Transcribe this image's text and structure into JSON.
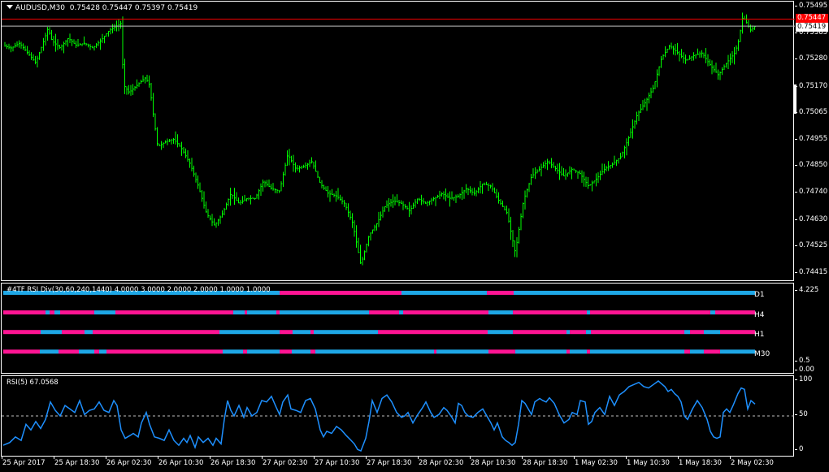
{
  "main": {
    "symbol_label": "AUDUSD,M30",
    "ohlc": "0.75428 0.75447 0.75397 0.75419",
    "ylim": [
      0.74395,
      0.75505
    ],
    "price_ticks": [
      "0.75495",
      "0.75385",
      "0.75280",
      "0.75170",
      "0.75065",
      "0.74955",
      "0.74850",
      "0.74740",
      "0.74630",
      "0.74525",
      "0.74415"
    ],
    "ask_level": 0.75447,
    "bid_level": 0.75419,
    "ask_tag": "0.75447",
    "bid_tag": "0.75419",
    "bar_color": "#00ff00",
    "ask_color": "#ff0000",
    "bid_color": "#c0c0c0",
    "price_path": [
      [
        0,
        0.7534
      ],
      [
        10,
        0.7533
      ],
      [
        20,
        0.7535
      ],
      [
        30,
        0.7531
      ],
      [
        40,
        0.7527
      ],
      [
        50,
        0.7536
      ],
      [
        55,
        0.7541
      ],
      [
        60,
        0.7536
      ],
      [
        70,
        0.7533
      ],
      [
        80,
        0.7537
      ],
      [
        90,
        0.7534
      ],
      [
        100,
        0.7535
      ],
      [
        110,
        0.7533
      ],
      [
        120,
        0.7536
      ],
      [
        130,
        0.754
      ],
      [
        140,
        0.7542
      ],
      [
        145,
        0.7543
      ],
      [
        148,
        0.7518
      ],
      [
        155,
        0.7515
      ],
      [
        165,
        0.7518
      ],
      [
        175,
        0.7521
      ],
      [
        180,
        0.7518
      ],
      [
        185,
        0.7505
      ],
      [
        190,
        0.7493
      ],
      [
        200,
        0.7495
      ],
      [
        210,
        0.7496
      ],
      [
        220,
        0.7492
      ],
      [
        230,
        0.7486
      ],
      [
        240,
        0.7477
      ],
      [
        250,
        0.7466
      ],
      [
        260,
        0.7461
      ],
      [
        270,
        0.7466
      ],
      [
        280,
        0.7474
      ],
      [
        290,
        0.747
      ],
      [
        300,
        0.7472
      ],
      [
        310,
        0.7472
      ],
      [
        320,
        0.7479
      ],
      [
        330,
        0.7476
      ],
      [
        340,
        0.7475
      ],
      [
        350,
        0.749
      ],
      [
        360,
        0.7484
      ],
      [
        370,
        0.7485
      ],
      [
        380,
        0.7487
      ],
      [
        390,
        0.7478
      ],
      [
        400,
        0.7474
      ],
      [
        410,
        0.7473
      ],
      [
        420,
        0.747
      ],
      [
        430,
        0.7462
      ],
      [
        440,
        0.7445
      ],
      [
        450,
        0.7457
      ],
      [
        460,
        0.7462
      ],
      [
        470,
        0.7469
      ],
      [
        480,
        0.7471
      ],
      [
        490,
        0.747
      ],
      [
        500,
        0.7467
      ],
      [
        510,
        0.7472
      ],
      [
        520,
        0.747
      ],
      [
        530,
        0.7472
      ],
      [
        540,
        0.7474
      ],
      [
        550,
        0.7472
      ],
      [
        560,
        0.7473
      ],
      [
        570,
        0.7476
      ],
      [
        580,
        0.7474
      ],
      [
        590,
        0.7478
      ],
      [
        600,
        0.7477
      ],
      [
        610,
        0.7471
      ],
      [
        620,
        0.7466
      ],
      [
        630,
        0.745
      ],
      [
        640,
        0.7471
      ],
      [
        650,
        0.7481
      ],
      [
        660,
        0.7484
      ],
      [
        670,
        0.7487
      ],
      [
        680,
        0.7484
      ],
      [
        690,
        0.7481
      ],
      [
        700,
        0.7484
      ],
      [
        710,
        0.7482
      ],
      [
        720,
        0.7477
      ],
      [
        730,
        0.748
      ],
      [
        740,
        0.7484
      ],
      [
        750,
        0.7486
      ],
      [
        760,
        0.7489
      ],
      [
        770,
        0.7497
      ],
      [
        780,
        0.7506
      ],
      [
        790,
        0.7511
      ],
      [
        800,
        0.7517
      ],
      [
        810,
        0.7529
      ],
      [
        820,
        0.7534
      ],
      [
        830,
        0.7531
      ],
      [
        840,
        0.7528
      ],
      [
        850,
        0.753
      ],
      [
        860,
        0.7531
      ],
      [
        870,
        0.7526
      ],
      [
        880,
        0.7522
      ],
      [
        890,
        0.7527
      ],
      [
        900,
        0.7531
      ],
      [
        905,
        0.7536
      ],
      [
        910,
        0.7546
      ],
      [
        915,
        0.7543
      ],
      [
        920,
        0.754
      ],
      [
        925,
        0.75419
      ]
    ]
  },
  "tf": {
    "title": "#4TF RSI Div(30,60,240,1440) 4.0000 3.0000 2.0000 2.0000 1.0000 1.0000",
    "ylim": [
      0.0,
      4.225
    ],
    "ticks": [
      "4.225",
      "0.5",
      "0.00"
    ],
    "magenta": "#ff1493",
    "cyan": "#1ea7e6",
    "rows": [
      {
        "label": "D1",
        "value": 4.0,
        "segments": [
          [
            "c",
            0,
            340
          ],
          [
            "m",
            340,
            355
          ],
          [
            "m",
            355,
            490
          ],
          [
            "c",
            490,
            595
          ],
          [
            "m",
            595,
            628
          ],
          [
            "c",
            628,
            925
          ]
        ]
      },
      {
        "label": "H4",
        "value": 3.0,
        "segments": [
          [
            "m",
            0,
            52
          ],
          [
            "c",
            52,
            57
          ],
          [
            "m",
            57,
            63
          ],
          [
            "c",
            63,
            70
          ],
          [
            "m",
            70,
            112
          ],
          [
            "c",
            112,
            138
          ],
          [
            "m",
            138,
            283
          ],
          [
            "c",
            283,
            297
          ],
          [
            "m",
            297,
            300
          ],
          [
            "c",
            300,
            336
          ],
          [
            "m",
            336,
            340
          ],
          [
            "c",
            340,
            450
          ],
          [
            "m",
            450,
            487
          ],
          [
            "c",
            487,
            492
          ],
          [
            "m",
            492,
            597
          ],
          [
            "c",
            597,
            627
          ],
          [
            "m",
            627,
            718
          ],
          [
            "c",
            718,
            722
          ],
          [
            "m",
            722,
            870
          ],
          [
            "c",
            870,
            876
          ],
          [
            "m",
            876,
            925
          ]
        ]
      },
      {
        "label": "H1",
        "value": 2.0,
        "segments": [
          [
            "m",
            0,
            46
          ],
          [
            "c",
            46,
            72
          ],
          [
            "m",
            72,
            100
          ],
          [
            "c",
            100,
            110
          ],
          [
            "m",
            110,
            137
          ],
          [
            "m",
            137,
            266
          ],
          [
            "c",
            266,
            340
          ],
          [
            "m",
            340,
            356
          ],
          [
            "c",
            356,
            378
          ],
          [
            "m",
            378,
            382
          ],
          [
            "c",
            382,
            461
          ],
          [
            "m",
            461,
            596
          ],
          [
            "c",
            596,
            627
          ],
          [
            "m",
            627,
            693
          ],
          [
            "c",
            693,
            697
          ],
          [
            "m",
            697,
            717
          ],
          [
            "c",
            717,
            723
          ],
          [
            "m",
            723,
            838
          ],
          [
            "c",
            838,
            845
          ],
          [
            "m",
            845,
            862
          ],
          [
            "c",
            862,
            882
          ],
          [
            "m",
            882,
            925
          ]
        ]
      },
      {
        "label": "M30",
        "value": 1.0,
        "segments": [
          [
            "m",
            0,
            45
          ],
          [
            "c",
            45,
            68
          ],
          [
            "m",
            68,
            93
          ],
          [
            "c",
            93,
            112
          ],
          [
            "m",
            112,
            118
          ],
          [
            "c",
            118,
            127
          ],
          [
            "m",
            127,
            137
          ],
          [
            "m",
            137,
            270
          ],
          [
            "c",
            270,
            295
          ],
          [
            "m",
            295,
            300
          ],
          [
            "c",
            300,
            340
          ],
          [
            "m",
            340,
            355
          ],
          [
            "c",
            355,
            378
          ],
          [
            "m",
            378,
            384
          ],
          [
            "c",
            384,
            530
          ],
          [
            "m",
            530,
            533
          ],
          [
            "c",
            533,
            597
          ],
          [
            "m",
            597,
            630
          ],
          [
            "c",
            630,
            693
          ],
          [
            "m",
            693,
            697
          ],
          [
            "c",
            697,
            718
          ],
          [
            "m",
            718,
            722
          ],
          [
            "c",
            722,
            838
          ],
          [
            "m",
            838,
            845
          ],
          [
            "c",
            845,
            862
          ],
          [
            "m",
            862,
            882
          ],
          [
            "c",
            882,
            925
          ]
        ]
      }
    ]
  },
  "rsi": {
    "label": "RSI(5) 67.0568",
    "ylim": [
      0,
      100
    ],
    "ticks": [
      "100",
      "50",
      "0"
    ],
    "level": 50,
    "line_color": "#1e90ff",
    "level_color": "#c0c0c0",
    "path": [
      [
        0,
        8
      ],
      [
        8,
        12
      ],
      [
        15,
        20
      ],
      [
        22,
        15
      ],
      [
        28,
        38
      ],
      [
        34,
        30
      ],
      [
        40,
        42
      ],
      [
        46,
        32
      ],
      [
        52,
        45
      ],
      [
        58,
        70
      ],
      [
        64,
        58
      ],
      [
        70,
        50
      ],
      [
        76,
        65
      ],
      [
        82,
        60
      ],
      [
        88,
        55
      ],
      [
        94,
        72
      ],
      [
        100,
        52
      ],
      [
        106,
        58
      ],
      [
        112,
        60
      ],
      [
        118,
        70
      ],
      [
        124,
        58
      ],
      [
        130,
        55
      ],
      [
        136,
        72
      ],
      [
        140,
        65
      ],
      [
        145,
        30
      ],
      [
        150,
        18
      ],
      [
        156,
        22
      ],
      [
        160,
        25
      ],
      [
        166,
        20
      ],
      [
        170,
        40
      ],
      [
        176,
        55
      ],
      [
        180,
        38
      ],
      [
        186,
        20
      ],
      [
        192,
        18
      ],
      [
        198,
        15
      ],
      [
        204,
        30
      ],
      [
        210,
        15
      ],
      [
        216,
        8
      ],
      [
        222,
        18
      ],
      [
        226,
        12
      ],
      [
        230,
        22
      ],
      [
        236,
        5
      ],
      [
        240,
        20
      ],
      [
        246,
        12
      ],
      [
        252,
        18
      ],
      [
        258,
        8
      ],
      [
        262,
        18
      ],
      [
        268,
        10
      ],
      [
        272,
        45
      ],
      [
        276,
        72
      ],
      [
        280,
        58
      ],
      [
        284,
        50
      ],
      [
        290,
        65
      ],
      [
        296,
        48
      ],
      [
        300,
        62
      ],
      [
        306,
        50
      ],
      [
        312,
        55
      ],
      [
        318,
        72
      ],
      [
        324,
        70
      ],
      [
        330,
        78
      ],
      [
        336,
        62
      ],
      [
        340,
        52
      ],
      [
        344,
        70
      ],
      [
        350,
        80
      ],
      [
        354,
        60
      ],
      [
        360,
        58
      ],
      [
        366,
        55
      ],
      [
        372,
        72
      ],
      [
        378,
        75
      ],
      [
        384,
        60
      ],
      [
        390,
        30
      ],
      [
        394,
        20
      ],
      [
        398,
        28
      ],
      [
        404,
        25
      ],
      [
        410,
        35
      ],
      [
        416,
        30
      ],
      [
        422,
        22
      ],
      [
        428,
        15
      ],
      [
        432,
        10
      ],
      [
        436,
        2
      ],
      [
        440,
        0
      ],
      [
        446,
        18
      ],
      [
        450,
        42
      ],
      [
        454,
        72
      ],
      [
        460,
        55
      ],
      [
        466,
        75
      ],
      [
        472,
        80
      ],
      [
        478,
        70
      ],
      [
        484,
        55
      ],
      [
        490,
        48
      ],
      [
        494,
        50
      ],
      [
        498,
        55
      ],
      [
        504,
        40
      ],
      [
        510,
        52
      ],
      [
        516,
        62
      ],
      [
        520,
        70
      ],
      [
        526,
        55
      ],
      [
        530,
        48
      ],
      [
        536,
        52
      ],
      [
        542,
        62
      ],
      [
        546,
        58
      ],
      [
        552,
        48
      ],
      [
        556,
        40
      ],
      [
        560,
        68
      ],
      [
        564,
        65
      ],
      [
        568,
        55
      ],
      [
        572,
        50
      ],
      [
        578,
        48
      ],
      [
        584,
        55
      ],
      [
        590,
        60
      ],
      [
        596,
        48
      ],
      [
        600,
        40
      ],
      [
        604,
        30
      ],
      [
        608,
        40
      ],
      [
        614,
        20
      ],
      [
        618,
        15
      ],
      [
        622,
        12
      ],
      [
        626,
        8
      ],
      [
        630,
        12
      ],
      [
        634,
        38
      ],
      [
        638,
        72
      ],
      [
        642,
        68
      ],
      [
        646,
        60
      ],
      [
        650,
        52
      ],
      [
        654,
        70
      ],
      [
        660,
        75
      ],
      [
        664,
        72
      ],
      [
        668,
        70
      ],
      [
        672,
        76
      ],
      [
        678,
        68
      ],
      [
        684,
        52
      ],
      [
        690,
        40
      ],
      [
        696,
        45
      ],
      [
        700,
        55
      ],
      [
        706,
        52
      ],
      [
        710,
        72
      ],
      [
        716,
        70
      ],
      [
        720,
        38
      ],
      [
        724,
        42
      ],
      [
        728,
        55
      ],
      [
        734,
        62
      ],
      [
        740,
        52
      ],
      [
        746,
        78
      ],
      [
        752,
        65
      ],
      [
        758,
        80
      ],
      [
        764,
        85
      ],
      [
        770,
        92
      ],
      [
        776,
        95
      ],
      [
        782,
        98
      ],
      [
        788,
        92
      ],
      [
        794,
        90
      ],
      [
        800,
        95
      ],
      [
        806,
        100
      ],
      [
        810,
        96
      ],
      [
        814,
        92
      ],
      [
        818,
        85
      ],
      [
        822,
        88
      ],
      [
        826,
        82
      ],
      [
        830,
        78
      ],
      [
        834,
        70
      ],
      [
        838,
        50
      ],
      [
        842,
        45
      ],
      [
        848,
        60
      ],
      [
        854,
        72
      ],
      [
        860,
        62
      ],
      [
        866,
        45
      ],
      [
        870,
        28
      ],
      [
        874,
        20
      ],
      [
        878,
        18
      ],
      [
        882,
        20
      ],
      [
        886,
        55
      ],
      [
        890,
        60
      ],
      [
        894,
        55
      ],
      [
        898,
        65
      ],
      [
        904,
        82
      ],
      [
        908,
        90
      ],
      [
        912,
        88
      ],
      [
        916,
        60
      ],
      [
        920,
        72
      ],
      [
        925,
        67
      ]
    ]
  },
  "xaxis": {
    "labels": [
      "25 Apr 2017",
      "25 Apr 18:30",
      "26 Apr 02:30",
      "26 Apr 10:30",
      "26 Apr 18:30",
      "27 Apr 02:30",
      "27 Apr 10:30",
      "27 Apr 18:30",
      "28 Apr 02:30",
      "28 Apr 10:30",
      "28 Apr 18:30",
      "1 May 02:30",
      "1 May 10:30",
      "1 May 18:30",
      "2 May 02:30"
    ]
  }
}
